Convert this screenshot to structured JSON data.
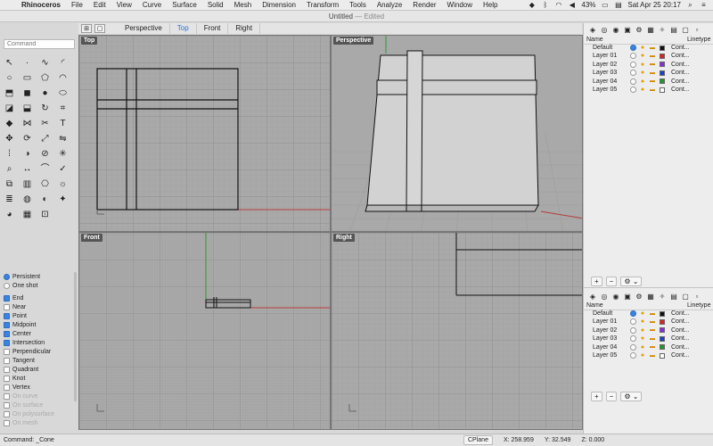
{
  "menubar": {
    "app": "Rhinoceros",
    "items": [
      "File",
      "Edit",
      "View",
      "Curve",
      "Surface",
      "Solid",
      "Mesh",
      "Dimension",
      "Transform",
      "Tools",
      "Analyze",
      "Render",
      "Window",
      "Help"
    ],
    "battery": "43%",
    "datetime": "Sat Apr 25  20:17"
  },
  "title": {
    "doc": "Untitled",
    "state": "— Edited"
  },
  "command": {
    "placeholder": "Command",
    "current": "Command: _Cone"
  },
  "viewport_tabs": [
    "Perspective",
    "Top",
    "Front",
    "Right"
  ],
  "active_tab": "Top",
  "viewports": {
    "top": "Top",
    "perspective": "Perspective",
    "front": "Front",
    "right": "Right"
  },
  "tool_icons": [
    "select-arrow-icon",
    "point-icon",
    "curve-icon",
    "fillet-icon",
    "circle-icon",
    "rectangle-icon",
    "polygon-icon",
    "arc-icon",
    "extrude-icon",
    "box-icon",
    "sphere-icon",
    "cylinder-icon",
    "surface-icon",
    "loft-icon",
    "revolve-icon",
    "network-icon",
    "solid-icon",
    "join-icon",
    "trim-icon",
    "text-icon",
    "move-icon",
    "rotate-icon",
    "scale-icon",
    "mirror-icon",
    "array-icon",
    "boolean-icon",
    "split-icon",
    "explode-icon",
    "analyze-icon",
    "dimension-icon",
    "curvature-icon",
    "check-icon",
    "group-icon",
    "block-icon",
    "camera-icon",
    "render-icon",
    "layer-icon",
    "material-icon",
    "color-icon",
    "light-icon",
    "globe-icon",
    "grid-icon",
    "cplane-icon"
  ],
  "osnap": {
    "modes": [
      {
        "label": "Persistent",
        "on": true
      },
      {
        "label": "One shot",
        "on": false
      }
    ],
    "items": [
      {
        "label": "End",
        "on": true,
        "dim": false
      },
      {
        "label": "Near",
        "on": false,
        "dim": false
      },
      {
        "label": "Point",
        "on": true,
        "dim": false
      },
      {
        "label": "Midpoint",
        "on": true,
        "dim": false
      },
      {
        "label": "Center",
        "on": true,
        "dim": false
      },
      {
        "label": "Intersection",
        "on": true,
        "dim": false
      },
      {
        "label": "Perpendicular",
        "on": false,
        "dim": false
      },
      {
        "label": "Tangent",
        "on": false,
        "dim": false
      },
      {
        "label": "Quadrant",
        "on": false,
        "dim": false
      },
      {
        "label": "Knot",
        "on": false,
        "dim": false
      },
      {
        "label": "Vertex",
        "on": false,
        "dim": false
      },
      {
        "label": "On curve",
        "on": false,
        "dim": true
      },
      {
        "label": "On surface",
        "on": false,
        "dim": true
      },
      {
        "label": "On polysurface",
        "on": false,
        "dim": true
      },
      {
        "label": "On mesh",
        "on": false,
        "dim": true
      }
    ]
  },
  "layers_header": {
    "name": "Name",
    "linetype": "Linetype"
  },
  "layers": [
    {
      "name": "Default",
      "color": "#111111",
      "current": true,
      "linetype": "Cont..."
    },
    {
      "name": "Layer 01",
      "color": "#e02020",
      "current": false,
      "linetype": "Cont..."
    },
    {
      "name": "Layer 02",
      "color": "#8a2be2",
      "current": false,
      "linetype": "Cont..."
    },
    {
      "name": "Layer 03",
      "color": "#1a3fd0",
      "current": false,
      "linetype": "Cont..."
    },
    {
      "name": "Layer 04",
      "color": "#1f9a2a",
      "current": false,
      "linetype": "Cont..."
    },
    {
      "name": "Layer 05",
      "color": "#ffffff",
      "current": false,
      "linetype": "Cont..."
    }
  ],
  "status": {
    "cplane": "CPlane",
    "x": "X: 258.959",
    "y": "Y: 32.549",
    "z": "Z: 0.000"
  }
}
